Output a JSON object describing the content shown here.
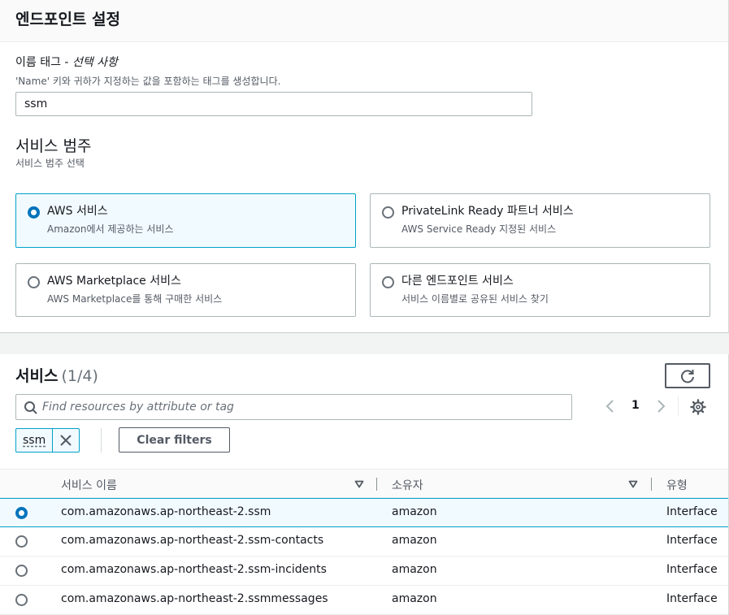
{
  "endpoint_settings": {
    "title": "엔드포인트 설정",
    "name_tag": {
      "label": "이름 태그 - ",
      "optional": "선택 사항",
      "description": "'Name' 키와 귀하가 지정하는 값을 포함하는 태그를 생성합니다.",
      "value": "ssm"
    },
    "service_category": {
      "heading": "서비스 범주",
      "description": "서비스 범주 선택",
      "options": [
        {
          "title": "AWS 서비스",
          "description": "Amazon에서 제공하는 서비스",
          "selected": true
        },
        {
          "title": "PrivateLink Ready 파트너 서비스",
          "description": "AWS Service Ready 지정된 서비스",
          "selected": false
        },
        {
          "title": "AWS Marketplace 서비스",
          "description": "AWS Marketplace를 통해 구매한 서비스",
          "selected": false
        },
        {
          "title": "다른 엔드포인트 서비스",
          "description": "서비스 이름별로 공유된 서비스 찾기",
          "selected": false
        }
      ]
    }
  },
  "services": {
    "title": "서비스",
    "count": "(1/4)",
    "search": {
      "placeholder": "Find resources by attribute or tag"
    },
    "pagination": {
      "current_page": "1"
    },
    "filter_token": "ssm",
    "clear_filters_label": "Clear filters",
    "columns": {
      "name": "서비스 이름",
      "owner": "소유자",
      "type": "유형"
    },
    "rows": [
      {
        "name": "com.amazonaws.ap-northeast-2.ssm",
        "owner": "amazon",
        "type": "Interface",
        "selected": true
      },
      {
        "name": "com.amazonaws.ap-northeast-2.ssm-contacts",
        "owner": "amazon",
        "type": "Interface",
        "selected": false
      },
      {
        "name": "com.amazonaws.ap-northeast-2.ssm-incidents",
        "owner": "amazon",
        "type": "Interface",
        "selected": false
      },
      {
        "name": "com.amazonaws.ap-northeast-2.ssmmessages",
        "owner": "amazon",
        "type": "Interface",
        "selected": false
      }
    ]
  },
  "colors": {
    "accent_blue": "#0073bb",
    "selected_border": "#00a1c9",
    "selected_bg": "#f1faff",
    "text": "#16191f",
    "secondary_text": "#545b64"
  }
}
